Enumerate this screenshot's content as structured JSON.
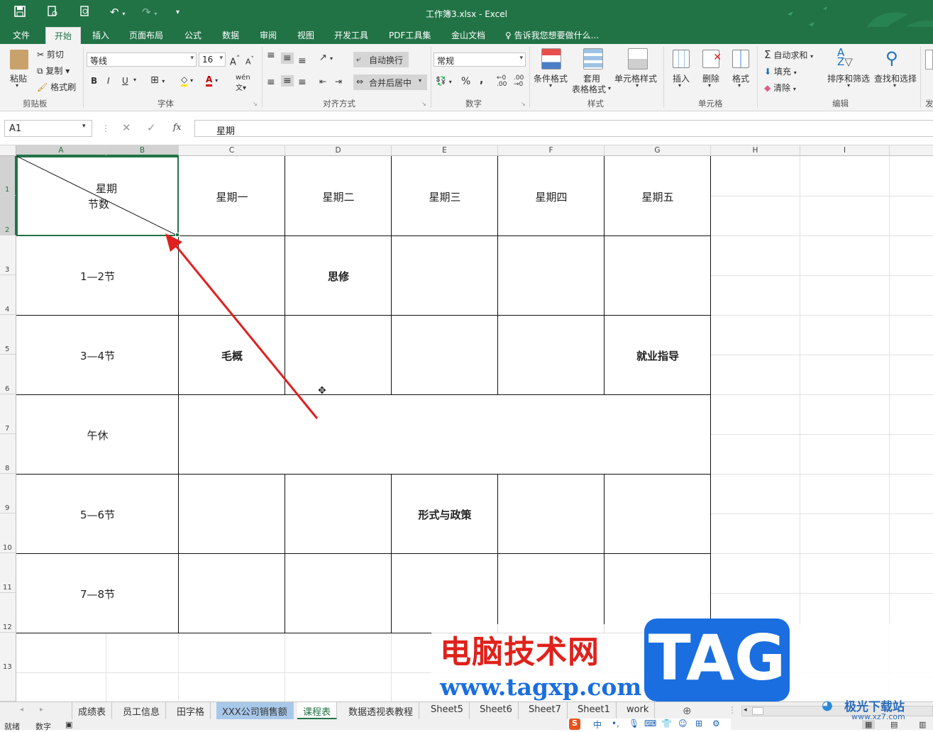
{
  "window_title": "工作簿3.xlsx - Excel",
  "colors": {
    "accent": "#217346",
    "arrow": "#e02020",
    "selection": "#217346",
    "watermark_red": "#e0211c",
    "watermark_blue": "#1a6ee0"
  },
  "tabs": [
    "文件",
    "开始",
    "插入",
    "页面布局",
    "公式",
    "数据",
    "审阅",
    "视图",
    "开发工具",
    "PDF工具集",
    "金山文档"
  ],
  "active_tab": "开始",
  "tell_me": "告诉我您想要做什么...",
  "ribbon": {
    "clipboard": {
      "paste": "粘贴",
      "cut": "剪切",
      "copy": "复制",
      "painter": "格式刷",
      "group": "剪贴板"
    },
    "font": {
      "name": "等线",
      "size": "16",
      "group": "字体",
      "bold": "B",
      "italic": "I",
      "underline": "U"
    },
    "align": {
      "wrap": "自动换行",
      "merge": "合并后居中",
      "group": "对齐方式"
    },
    "number": {
      "format": "常规",
      "group": "数字",
      "percent": "%",
      "comma": ","
    },
    "styles": {
      "cond": "条件格式",
      "table_l1": "套用",
      "table_l2": "表格格式",
      "cell": "单元格样式",
      "group": "样式"
    },
    "cells": {
      "insert": "插入",
      "delete": "删除",
      "format": "格式",
      "group": "单元格"
    },
    "editing": {
      "autosum": "自动求和",
      "fill": "填充",
      "clear": "清除",
      "sort": "排序和筛选",
      "find": "查找和选择",
      "group": "编辑",
      "cut_off": "发"
    }
  },
  "formula_bar": {
    "name_box": "A1",
    "content": "星期",
    "fx": "fx"
  },
  "columns": [
    "A",
    "B",
    "C",
    "D",
    "E",
    "F",
    "G",
    "H",
    "I"
  ],
  "rows": [
    "1",
    "2",
    "3",
    "4",
    "5",
    "6",
    "7",
    "8",
    "9",
    "10",
    "11",
    "12",
    "13"
  ],
  "header_cell": {
    "top": "星期",
    "bottom": "节数"
  },
  "days": [
    "星期一",
    "星期二",
    "星期三",
    "星期四",
    "星期五"
  ],
  "periods": [
    "1—2节",
    "3—4节",
    "午休",
    "5—6节",
    "7—8节"
  ],
  "courses": {
    "d3": "思修",
    "c5": "毛概",
    "g5": "就业指导",
    "e9": "形式与政策"
  },
  "sheet_tabs": [
    "成绩表",
    "员工信息",
    "田字格",
    "XXX公司销售额",
    "课程表",
    "数据透视表教程",
    "Sheet5",
    "Sheet6",
    "Sheet7",
    "Sheet1",
    "work"
  ],
  "active_sheet": "课程表",
  "status": {
    "ready": "就绪",
    "num": "数字"
  },
  "watermark": {
    "title": "电脑技术网",
    "url": "www.tagxp.com",
    "logo": "TAG",
    "site": "极光下载站",
    "site_url": "www.xz7.com"
  }
}
